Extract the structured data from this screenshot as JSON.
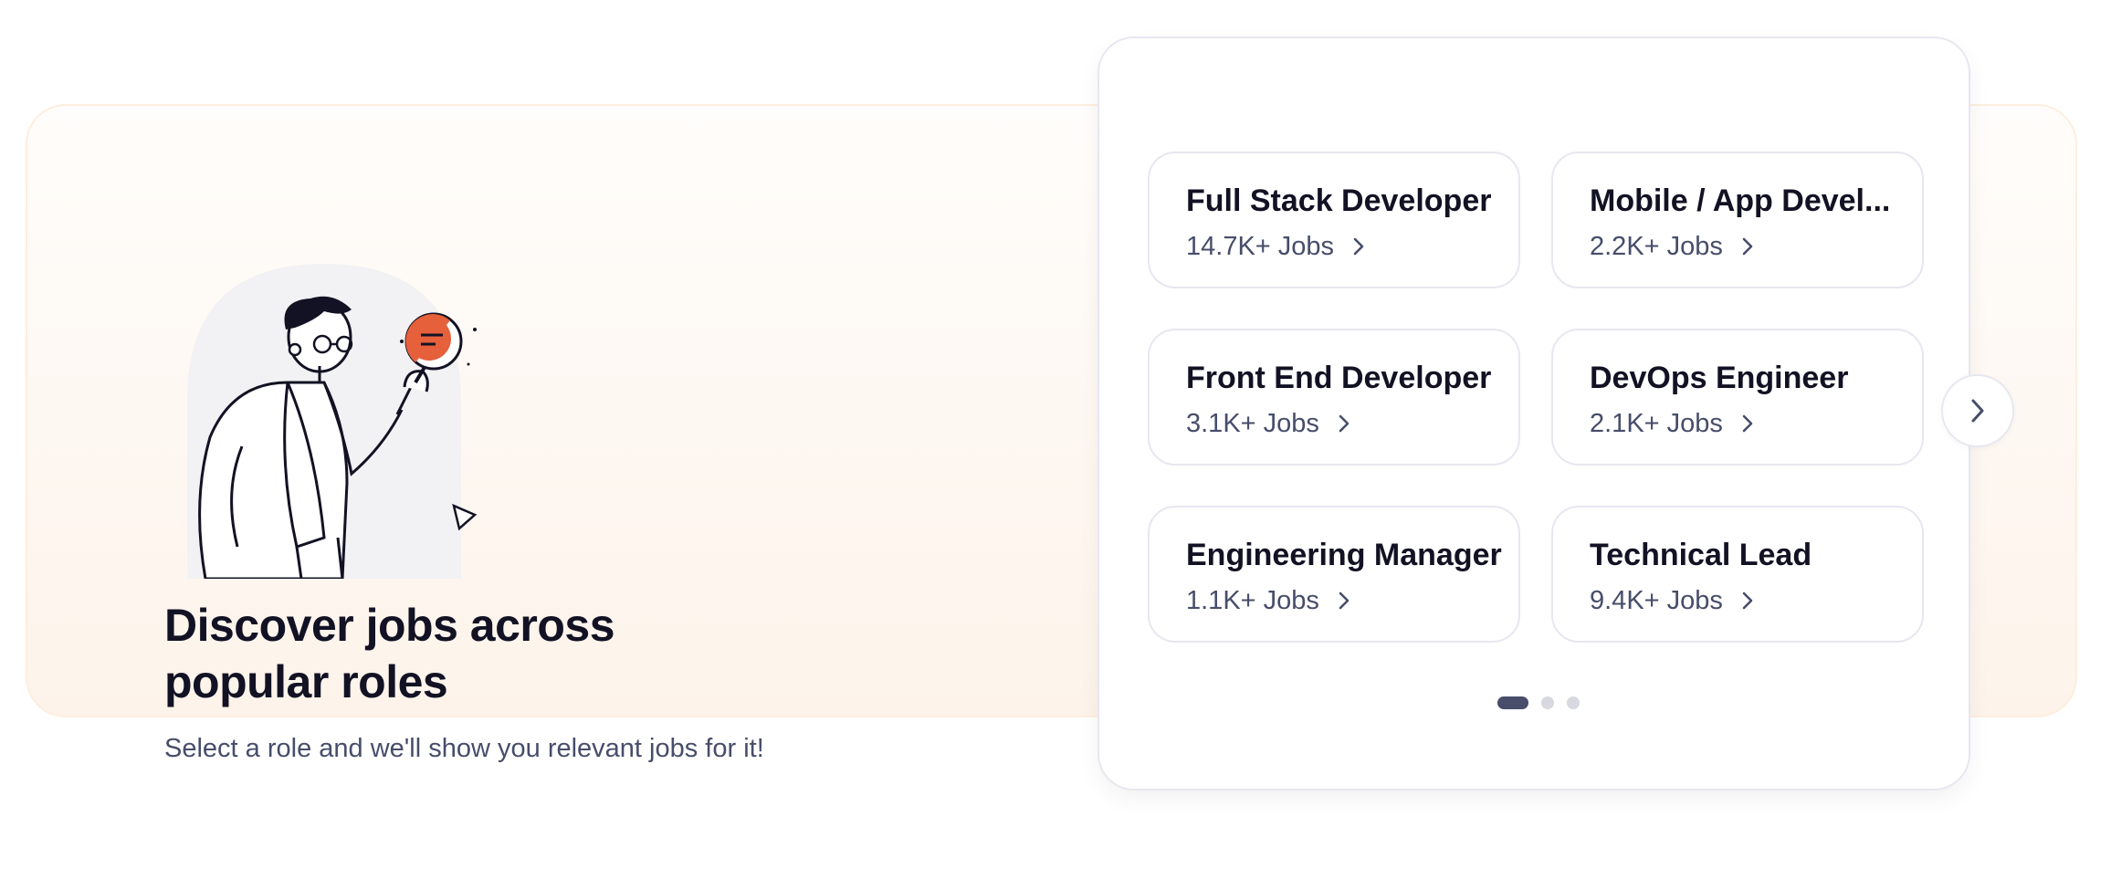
{
  "banner": {
    "headline": "Discover jobs across popular roles",
    "subline": "Select a role and we'll show you relevant jobs for it!",
    "illustration": "person-with-magnifier-illustration"
  },
  "roles": [
    {
      "title": "Full Stack Developer",
      "count": "14.7K+ Jobs"
    },
    {
      "title": "Mobile / App Devel...",
      "count": "2.2K+ Jobs"
    },
    {
      "title": "Front End Developer",
      "count": "3.1K+ Jobs"
    },
    {
      "title": "DevOps Engineer",
      "count": "2.1K+ Jobs"
    },
    {
      "title": "Engineering Manager",
      "count": "1.1K+ Jobs"
    },
    {
      "title": "Technical Lead",
      "count": "9.4K+ Jobs"
    }
  ],
  "carousel": {
    "next_icon": "chevron-right-icon",
    "pages": 3,
    "active_page": 1
  },
  "colors": {
    "heading": "#121224",
    "muted_text": "#474d6a",
    "banner_bg": "#fdf3ea",
    "card_border": "#e7e7f1",
    "accent": "#e5603b"
  }
}
